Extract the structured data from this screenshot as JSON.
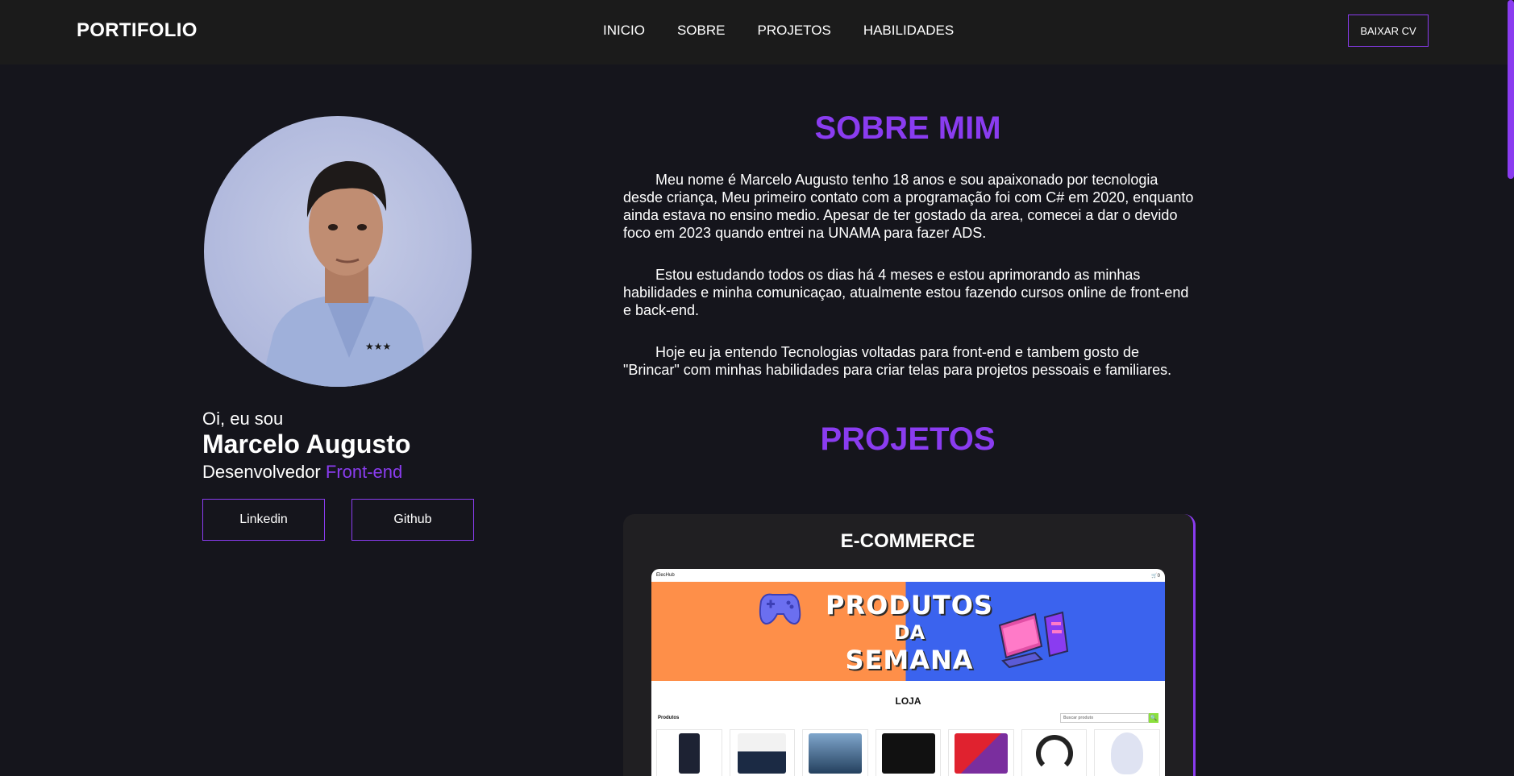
{
  "header": {
    "logo": "PORTIFOLIO",
    "nav": [
      "INICIO",
      "SOBRE",
      "PROJETOS",
      "HABILIDADES"
    ],
    "cv_button": "BAIXAR CV"
  },
  "profile": {
    "greeting": "Oi, eu sou",
    "name": "Marcelo Augusto",
    "role_prefix": "Desenvolvedor",
    "role_accent": "Front-end",
    "linkedin_label": "Linkedin",
    "github_label": "Github"
  },
  "about": {
    "title": "SOBRE MIM",
    "paragraphs": [
      "Meu nome é Marcelo Augusto tenho 18 anos e sou apaixonado por tecnologia desde criança, Meu primeiro contato com a programação foi com C# em 2020, enquanto ainda estava no ensino medio. Apesar de ter gostado da area, comecei a dar o devido foco em 2023 quando entrei na UNAMA para fazer ADS.",
      "Estou estudando todos os dias há 4 meses e estou aprimorando as minhas habilidades e minha comunicaçao, atualmente estou fazendo cursos online de front-end e back-end.",
      "Hoje eu ja entendo Tecnologias voltadas para front-end e tambem gosto de \"Brincar\" com minhas habilidades para criar telas para projetos pessoais e familiares."
    ]
  },
  "projects": {
    "title": "PROJETOS",
    "card_title": "E-COMMERCE",
    "preview": {
      "brand": "ElecHub",
      "cart": "🛒0",
      "banner_line1": "PRODUTOS",
      "banner_line2": "DA",
      "banner_line3": "SEMANA",
      "store_title": "LOJA",
      "products_label": "Produtos",
      "search_placeholder": "Buscar produto",
      "search_icon": "🔍"
    }
  },
  "colors": {
    "accent": "#8a3cf0",
    "background": "#15151c",
    "header": "#1b1b1b"
  }
}
